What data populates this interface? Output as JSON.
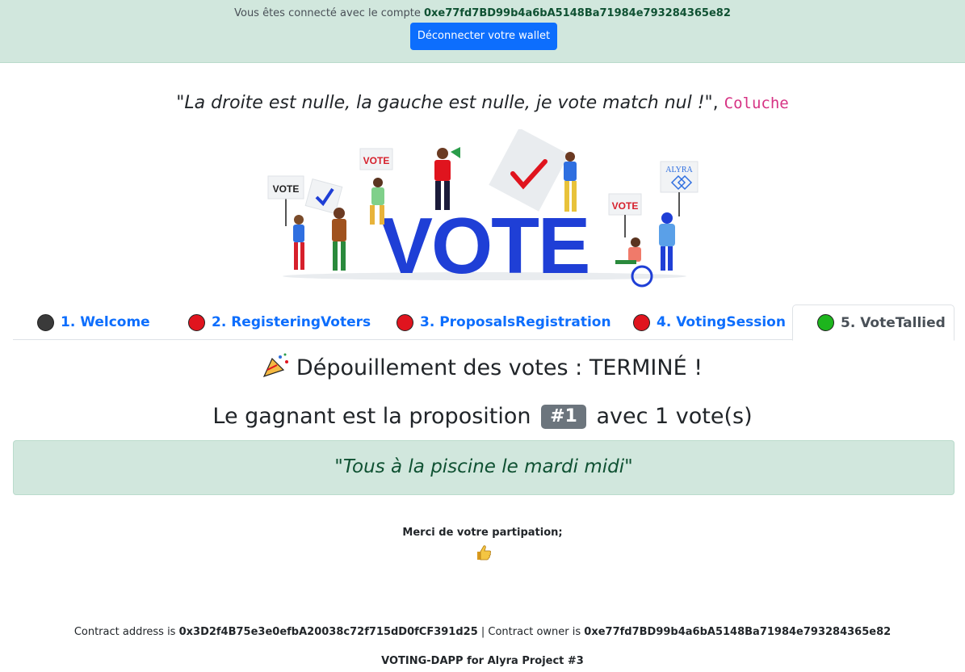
{
  "banner": {
    "connected_prefix": "Vous êtes connecté avec le compte ",
    "account": "0xe77fd7BD99b4a6bA5148Ba71984e793284365e82",
    "disconnect_label": "Déconnecter votre wallet"
  },
  "quote": {
    "text": "\"La droite est nulle, la gauche est nulle, je vote match nul !\"",
    "separator": ", ",
    "author": "Coluche"
  },
  "illustration": {
    "big_word": "VOTE",
    "sign_vote": "VOTE",
    "sign_brand": "ALYRA"
  },
  "tabs": [
    {
      "label": "1. Welcome",
      "status_color": "#3a3a3a"
    },
    {
      "label": "2. RegisteringVoters",
      "status_color": "#e0141e"
    },
    {
      "label": "3. ProposalsRegistration",
      "status_color": "#e0141e"
    },
    {
      "label": "4. VotingSession",
      "status_color": "#e0141e"
    },
    {
      "label": "5. VoteTallied",
      "status_color": "#1db51d",
      "active": true
    }
  ],
  "results": {
    "title": "Dépouillement des votes : TERMINÉ !",
    "winner_prefix": "Le gagnant est la proposition",
    "winner_badge": "#1",
    "winner_suffix": "avec 1 vote(s)",
    "winning_proposal": "Tous à la piscine le mardi midi"
  },
  "thanks": "Merci de votre partipation;",
  "footer": {
    "contract_label": "Contract address is ",
    "contract_address": "0x3D2f4B75e3e0efbA20038c72f715dD0fCF391d25",
    "owner_label": " | Contract owner is ",
    "owner_address": "0xe77fd7BD99b4a6bA5148Ba71984e793284365e82",
    "project": "VOTING-DAPP for Alyra Project #3"
  },
  "colors": {
    "banner_bg": "#d1e7dd",
    "primary": "#0d6efd",
    "success_text": "#0f5132",
    "badge_bg": "#6c757d",
    "vote_blue": "#1f3fd6"
  }
}
